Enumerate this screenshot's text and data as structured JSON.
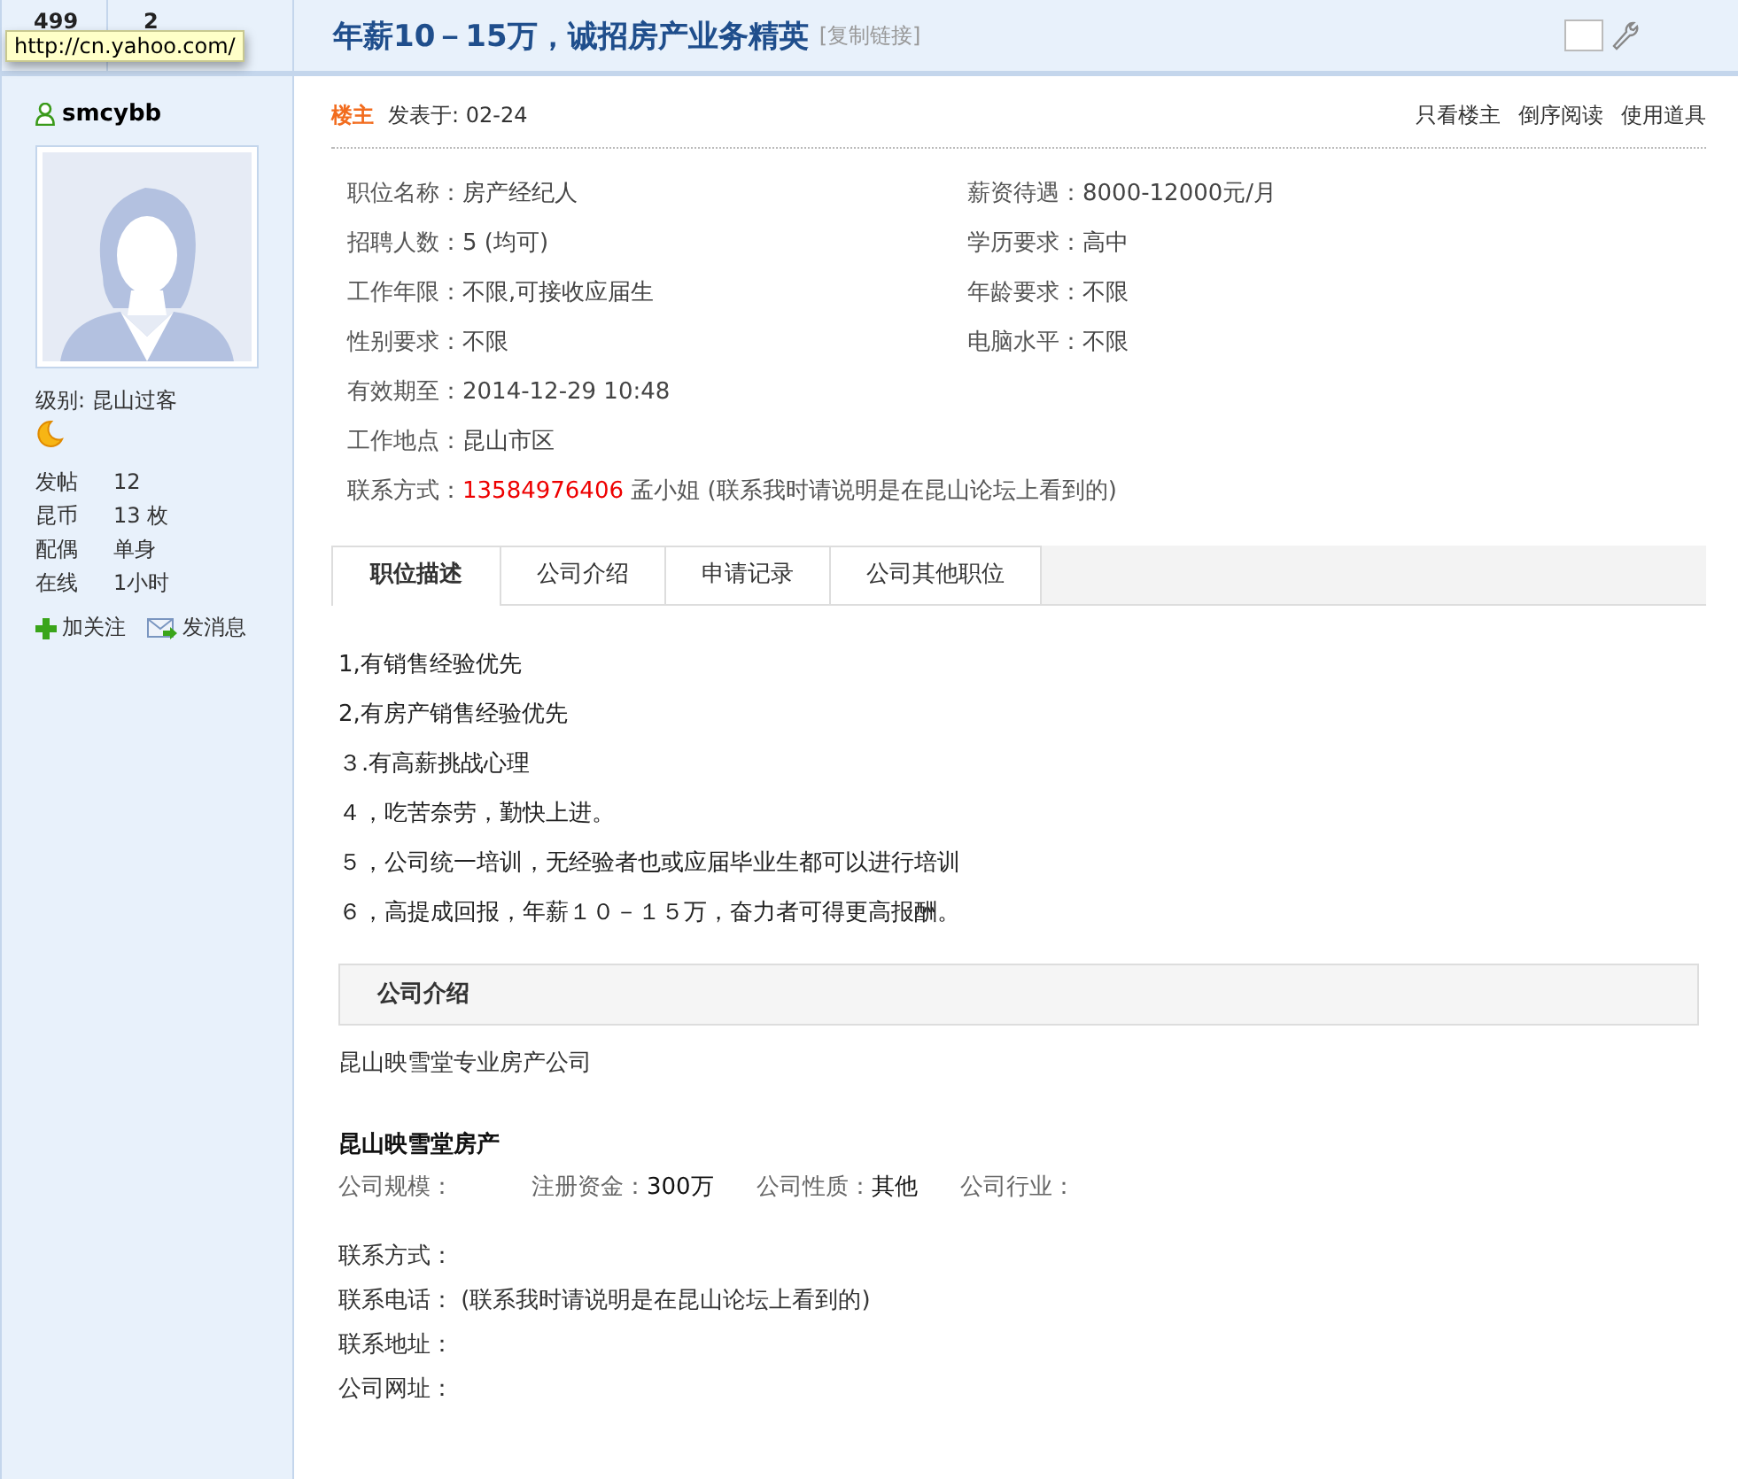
{
  "tooltip": "http://cn.yahoo.com/",
  "header": {
    "stats": [
      "499",
      "2"
    ],
    "checkbox_checked": false,
    "title": "年薪10－15万，诚招房产业务精英",
    "copy_link": "[复制链接]"
  },
  "author": {
    "name": "smcybb",
    "level": "级别: 昆山过客",
    "stats": [
      {
        "label": "发帖",
        "value": "12"
      },
      {
        "label": "昆币",
        "value": "13 枚"
      },
      {
        "label": "配偶",
        "value": "单身"
      },
      {
        "label": "在线",
        "value": "1小时"
      }
    ],
    "actions": [
      {
        "kind": "follow",
        "label": "加关注"
      },
      {
        "kind": "message",
        "label": "发消息"
      }
    ]
  },
  "post": {
    "badge": "楼主",
    "posted": "发表于: 02-24",
    "tools": [
      "只看楼主",
      "倒序阅读",
      "使用道具"
    ]
  },
  "field_rows": [
    [
      {
        "label": "职位名称：",
        "value": "房产经纪人"
      },
      {
        "label": "薪资待遇：",
        "value": "8000-12000元/月"
      }
    ],
    [
      {
        "label": "招聘人数：",
        "value": "5 (均可)"
      },
      {
        "label": "学历要求：",
        "value": "高中"
      }
    ],
    [
      {
        "label": "工作年限：",
        "value": "不限,可接收应届生"
      },
      {
        "label": "年龄要求：",
        "value": "不限"
      }
    ],
    [
      {
        "label": "性别要求：",
        "value": "不限"
      },
      {
        "label": "电脑水平：",
        "value": "不限"
      }
    ],
    [
      {
        "label": "有效期至：",
        "value": "2014-12-29 10:48"
      }
    ],
    [
      {
        "label": "工作地点：",
        "value": "昆山市区"
      }
    ]
  ],
  "contact": {
    "label": "联系方式：",
    "phone": "13584976406",
    "name": "孟小姐",
    "note": "(联系我时请说明是在昆山论坛上看到的)"
  },
  "tabs": [
    {
      "label": "职位描述",
      "selected": true
    },
    {
      "label": "公司介绍",
      "selected": false
    },
    {
      "label": "申请记录",
      "selected": false
    },
    {
      "label": "公司其他职位",
      "selected": false
    }
  ],
  "description": [
    "1,有销售经验优先",
    "2,有房产销售经验优先",
    "３.有高薪挑战心理",
    "４，吃苦奈劳，勤快上进。",
    "５，公司统一培训，无经验者也或应届毕业生都可以进行培训",
    "６，高提成回报，年薪１０－１５万，奋力者可得更高报酬。"
  ],
  "company": {
    "heading": "公司介绍",
    "intro": "昆山映雪堂专业房产公司",
    "name": "昆山映雪堂房产",
    "facts": [
      {
        "label": "公司规模："
      },
      {
        "label": "注册资金：",
        "value": "300万"
      },
      {
        "label": "公司性质：",
        "value": "其他"
      },
      {
        "label": "公司行业："
      }
    ],
    "contacts": [
      {
        "label": "联系方式："
      },
      {
        "label": "联系电话：",
        "value": "(联系我时请说明是在昆山论坛上看到的)"
      },
      {
        "label": "联系地址："
      },
      {
        "label": "公司网址："
      }
    ]
  }
}
